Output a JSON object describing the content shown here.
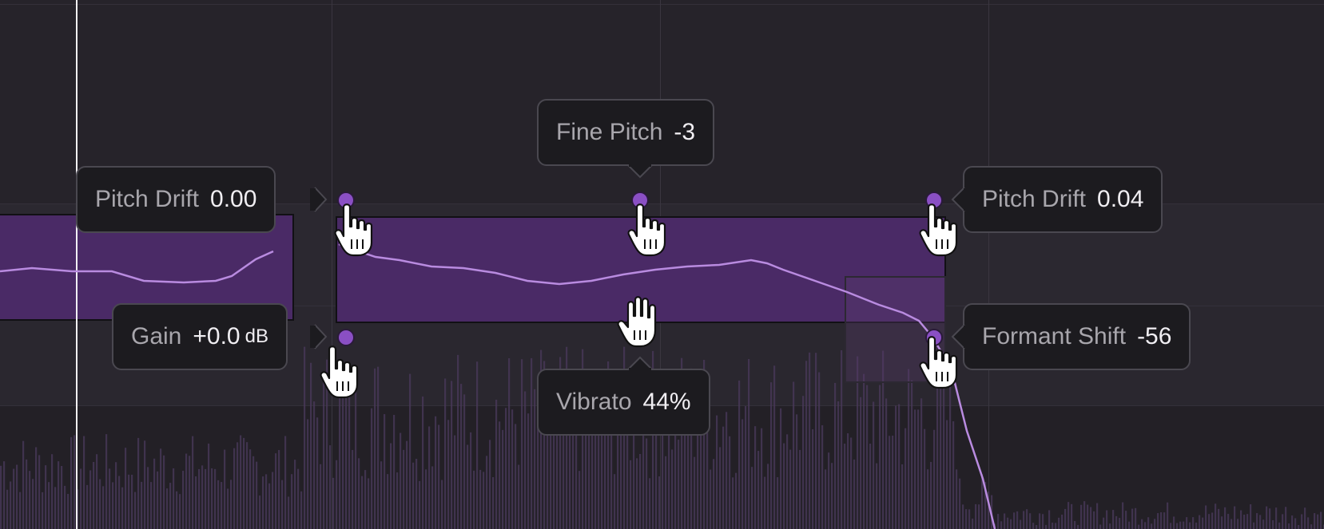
{
  "tooltips": {
    "pitch_drift_left": {
      "label": "Pitch Drift",
      "value": "0.00"
    },
    "gain": {
      "label": "Gain",
      "value": "+0.0",
      "unit": "dB"
    },
    "fine_pitch": {
      "label": "Fine Pitch",
      "value": "-3"
    },
    "vibrato": {
      "label": "Vibrato",
      "value": "44%"
    },
    "pitch_drift_right": {
      "label": "Pitch Drift",
      "value": "0.04"
    },
    "formant_shift": {
      "label": "Formant Shift",
      "value": "-56"
    }
  },
  "icons": {
    "handle": "circle-handle-icon",
    "cursor": "hand-cursor-icon"
  },
  "colors": {
    "background": "#252229",
    "note_fill": "#4a2a66",
    "handle": "#8a4fc4",
    "pitch_curve": "#b98be0",
    "tooltip_bg": "#1c1b1f",
    "tooltip_border": "#4a4850",
    "playhead": "#f2f0f4"
  }
}
